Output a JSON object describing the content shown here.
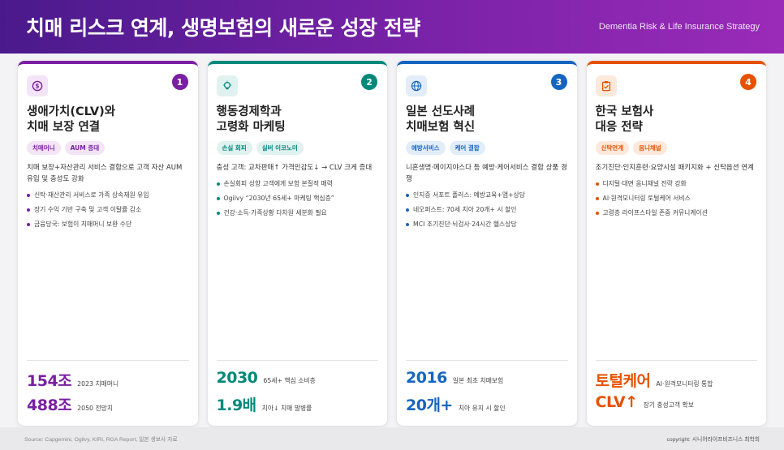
{
  "header": {
    "title": "치매 리스크 연계, 생명보험의 새로운 성장 전략",
    "subtitle": "Dementia Risk & Life Insurance Strategy"
  },
  "cards": [
    {
      "number": "1",
      "icon": "dollar-coin-icon",
      "accent": "#7a1fa2",
      "tint": "#f3e5f7",
      "title": "생애가치(CLV)와\n치매 보장 연결",
      "tags": [
        "치매머니",
        "AUM 증대"
      ],
      "desc": "치매 보장+자산관리 서비스 결합으로 고객 자산 AUM 유입 및 충성도 강화",
      "bullets": [
        "신탁·재산관리 서비스로 가족 상속재원 유입",
        "장기 수익 기반 구축 및 고객 이탈률 감소",
        "금융당국: 보험이 치매머니 보완 수단"
      ],
      "stats": [
        {
          "value": "154조",
          "label": "2023 치매머니"
        },
        {
          "value": "488조",
          "label": "2050 전망치"
        }
      ]
    },
    {
      "number": "2",
      "icon": "lightbulb-icon",
      "accent": "#00897b",
      "tint": "#e0f2ef",
      "title": "행동경제학과\n고령화 마케팅",
      "tags": [
        "손실 회피",
        "실버 이코노미"
      ],
      "desc": "충성 고객: 교차판매↑ 가격민감도↓ → CLV 크게 증대",
      "bullets": [
        "손실회피 성향 고객에게 보험 본질적 매력",
        "Ogilvy “2030년 65세+ 마케팅 핵심층”",
        "건강·소득·가족상황 다차원 세분화 필요"
      ],
      "stats": [
        {
          "value": "2030",
          "label": "65세+ 핵심 소비층"
        },
        {
          "value": "1.9배",
          "label": "치아↓ 치매 발병률"
        }
      ]
    },
    {
      "number": "3",
      "icon": "globe-icon",
      "accent": "#1565c0",
      "tint": "#e3edf9",
      "title": "일본 선도사례\n치매보험 혁신",
      "tags": [
        "예방서비스",
        "케어 결합"
      ],
      "desc": "니혼생명·메이지야스다 등 예방·케어서비스 결합 상품 경쟁",
      "bullets": [
        "인지증 서포트 플러스: 예방교육+앱+상담",
        "네오퍼스트: 70세 치아 20개+ 시 할인",
        "MCI 조기진단·뇌검사·24시간 헬스상담"
      ],
      "stats": [
        {
          "value": "2016",
          "label": "일본 최초 치매보험"
        },
        {
          "value": "20개+",
          "label": "치아 유지 시 할인"
        }
      ]
    },
    {
      "number": "4",
      "icon": "clipboard-icon",
      "accent": "#e65100",
      "tint": "#fde8dc",
      "title": "한국 보험사\n대응 전략",
      "tags": [
        "신탁연계",
        "옴니채널"
      ],
      "desc": "조기진단·인지훈련·요양시설 패키지화 + 신탁옵션 연계",
      "bullets": [
        "디지털·대면 옴니채널 전략 강화",
        "AI·원격모니터링 토털케어 서비스",
        "고령층 라이프스타일 존중 커뮤니케이션"
      ],
      "stats": [
        {
          "value": "토털케어",
          "label": "AI·원격모니터링 통합"
        },
        {
          "value": "CLV↑",
          "label": "장기 충성고객 확보"
        }
      ]
    }
  ],
  "footer": {
    "source": "Source: Capgemini, Ogilvy, KIRI, RGA Report, 일본 생보사 자료",
    "copyright": "copyright: 시니어라이프비즈니스 최학희"
  }
}
